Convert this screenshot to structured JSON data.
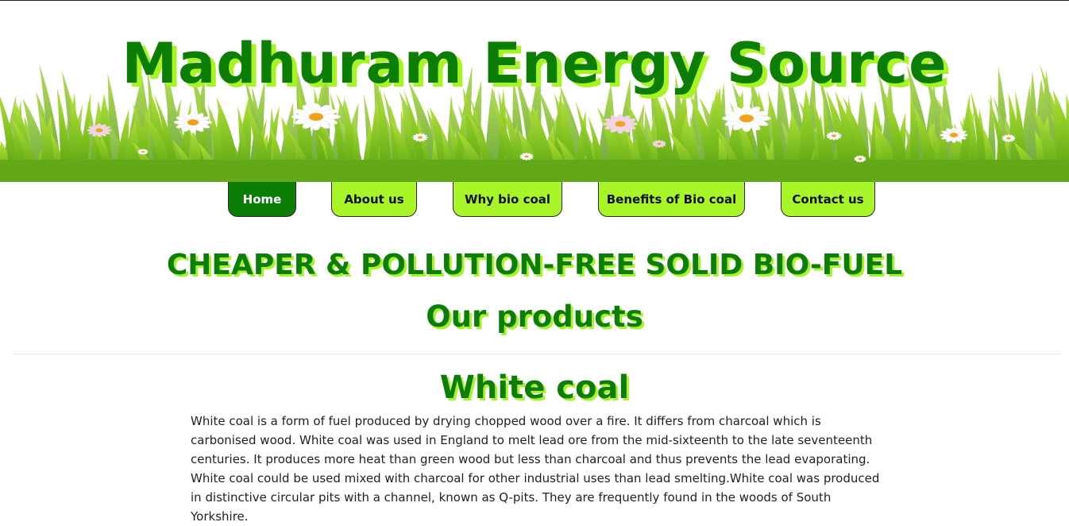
{
  "site": {
    "title": "Madhuram Energy Source"
  },
  "nav": {
    "items": [
      {
        "label": "Home",
        "active": true
      },
      {
        "label": "About us",
        "active": false
      },
      {
        "label": "Why bio coal",
        "active": false
      },
      {
        "label": "Benefits of Bio coal",
        "active": false
      },
      {
        "label": "Contact us",
        "active": false
      }
    ]
  },
  "main": {
    "headline": "CHEAPER & POLLUTION-FREE SOLID BIO-FUEL",
    "products_heading": "Our products",
    "section": {
      "title": "White coal",
      "text": "White coal is a form of fuel produced by drying chopped wood over a fire. It differs from charcoal which is carbonised wood. White coal was used in England to melt lead ore from the mid-sixteenth to the late seventeenth centuries. It produces more heat than green wood but less than charcoal and thus prevents the lead evaporating. White coal could be used mixed with charcoal for other industrial uses than lead smelting.White coal was produced in distinctive circular pits with a channel, known as Q-pits. They are frequently found in the woods of South Yorkshire."
    }
  },
  "colors": {
    "brand_green": "#0c7d05",
    "accent_lime": "#a8f52a",
    "text": "#222222"
  },
  "icons": {
    "banner": "grass-and-daisies-illustration"
  }
}
